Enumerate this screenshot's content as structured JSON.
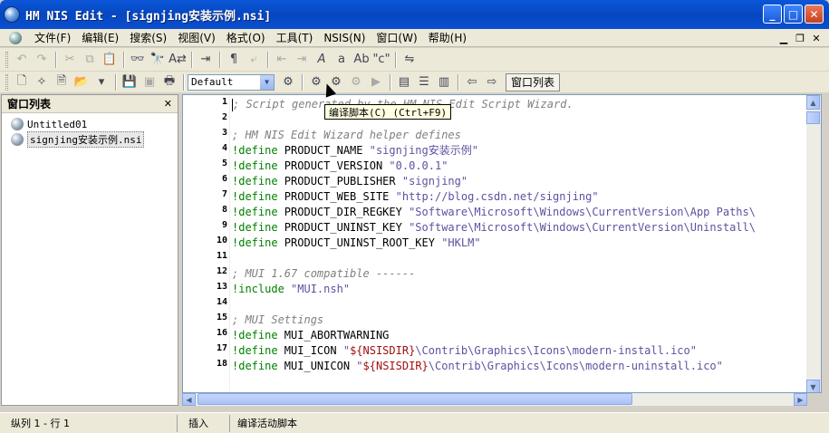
{
  "window": {
    "title": "HM NIS Edit - [signjing安装示例.nsi]"
  },
  "menu": [
    "文件(F)",
    "编辑(E)",
    "搜索(S)",
    "视图(V)",
    "格式(O)",
    "工具(T)",
    "NSIS(N)",
    "窗口(W)",
    "帮助(H)"
  ],
  "toolbar": {
    "config_combo": "Default",
    "window_list_label": "窗口列表"
  },
  "tooltip": "编译脚本(C) (Ctrl+F9)",
  "panel": {
    "title": "窗口列表",
    "files": [
      "Untitled01",
      "signjing安装示例.nsi"
    ]
  },
  "editor": {
    "line_numbers": [
      "1",
      "2",
      "3",
      "4",
      "5",
      "6",
      "7",
      "8",
      "9",
      "10",
      "11",
      "12",
      "13",
      "14",
      "15",
      "16",
      "17",
      "18"
    ],
    "lines": [
      "; Script generated by the HM NIS Edit Script Wizard.",
      "",
      "; HM NIS Edit Wizard helper defines",
      "!define PRODUCT_NAME \"signjing安装示例\"",
      "!define PRODUCT_VERSION \"0.0.0.1\"",
      "!define PRODUCT_PUBLISHER \"signjing\"",
      "!define PRODUCT_WEB_SITE \"http://blog.csdn.net/signjing\"",
      "!define PRODUCT_DIR_REGKEY \"Software\\Microsoft\\Windows\\CurrentVersion\\App Paths\\",
      "!define PRODUCT_UNINST_KEY \"Software\\Microsoft\\Windows\\CurrentVersion\\Uninstall\\",
      "!define PRODUCT_UNINST_ROOT_KEY \"HKLM\"",
      "",
      "; MUI 1.67 compatible ------",
      "!include \"MUI.nsh\"",
      "",
      "; MUI Settings",
      "!define MUI_ABORTWARNING",
      "!define MUI_ICON \"${NSISDIR}\\Contrib\\Graphics\\Icons\\modern-install.ico\"",
      "!define MUI_UNICON \"${NSISDIR}\\Contrib\\Graphics\\Icons\\modern-uninstall.ico\""
    ]
  },
  "status": {
    "position": "纵列 1 - 行 1",
    "mode": "插入",
    "message": "编译活动脚本"
  }
}
